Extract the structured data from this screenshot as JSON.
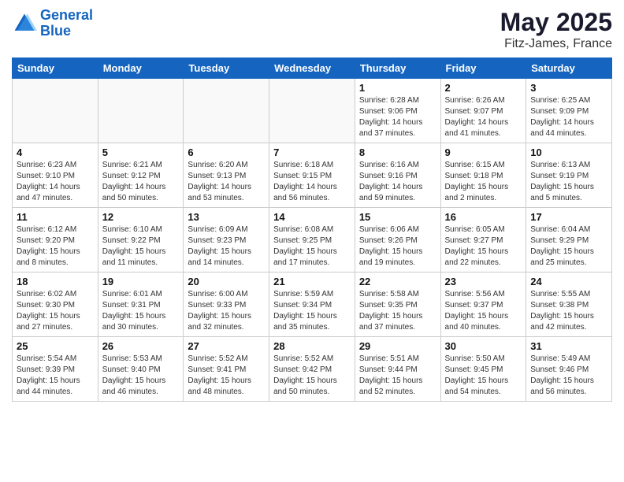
{
  "header": {
    "logo_line1": "General",
    "logo_line2": "Blue",
    "main_title": "May 2025",
    "subtitle": "Fitz-James, France"
  },
  "days_of_week": [
    "Sunday",
    "Monday",
    "Tuesday",
    "Wednesday",
    "Thursday",
    "Friday",
    "Saturday"
  ],
  "weeks": [
    [
      {
        "day": "",
        "info": ""
      },
      {
        "day": "",
        "info": ""
      },
      {
        "day": "",
        "info": ""
      },
      {
        "day": "",
        "info": ""
      },
      {
        "day": "1",
        "info": "Sunrise: 6:28 AM\nSunset: 9:06 PM\nDaylight: 14 hours\nand 37 minutes."
      },
      {
        "day": "2",
        "info": "Sunrise: 6:26 AM\nSunset: 9:07 PM\nDaylight: 14 hours\nand 41 minutes."
      },
      {
        "day": "3",
        "info": "Sunrise: 6:25 AM\nSunset: 9:09 PM\nDaylight: 14 hours\nand 44 minutes."
      }
    ],
    [
      {
        "day": "4",
        "info": "Sunrise: 6:23 AM\nSunset: 9:10 PM\nDaylight: 14 hours\nand 47 minutes."
      },
      {
        "day": "5",
        "info": "Sunrise: 6:21 AM\nSunset: 9:12 PM\nDaylight: 14 hours\nand 50 minutes."
      },
      {
        "day": "6",
        "info": "Sunrise: 6:20 AM\nSunset: 9:13 PM\nDaylight: 14 hours\nand 53 minutes."
      },
      {
        "day": "7",
        "info": "Sunrise: 6:18 AM\nSunset: 9:15 PM\nDaylight: 14 hours\nand 56 minutes."
      },
      {
        "day": "8",
        "info": "Sunrise: 6:16 AM\nSunset: 9:16 PM\nDaylight: 14 hours\nand 59 minutes."
      },
      {
        "day": "9",
        "info": "Sunrise: 6:15 AM\nSunset: 9:18 PM\nDaylight: 15 hours\nand 2 minutes."
      },
      {
        "day": "10",
        "info": "Sunrise: 6:13 AM\nSunset: 9:19 PM\nDaylight: 15 hours\nand 5 minutes."
      }
    ],
    [
      {
        "day": "11",
        "info": "Sunrise: 6:12 AM\nSunset: 9:20 PM\nDaylight: 15 hours\nand 8 minutes."
      },
      {
        "day": "12",
        "info": "Sunrise: 6:10 AM\nSunset: 9:22 PM\nDaylight: 15 hours\nand 11 minutes."
      },
      {
        "day": "13",
        "info": "Sunrise: 6:09 AM\nSunset: 9:23 PM\nDaylight: 15 hours\nand 14 minutes."
      },
      {
        "day": "14",
        "info": "Sunrise: 6:08 AM\nSunset: 9:25 PM\nDaylight: 15 hours\nand 17 minutes."
      },
      {
        "day": "15",
        "info": "Sunrise: 6:06 AM\nSunset: 9:26 PM\nDaylight: 15 hours\nand 19 minutes."
      },
      {
        "day": "16",
        "info": "Sunrise: 6:05 AM\nSunset: 9:27 PM\nDaylight: 15 hours\nand 22 minutes."
      },
      {
        "day": "17",
        "info": "Sunrise: 6:04 AM\nSunset: 9:29 PM\nDaylight: 15 hours\nand 25 minutes."
      }
    ],
    [
      {
        "day": "18",
        "info": "Sunrise: 6:02 AM\nSunset: 9:30 PM\nDaylight: 15 hours\nand 27 minutes."
      },
      {
        "day": "19",
        "info": "Sunrise: 6:01 AM\nSunset: 9:31 PM\nDaylight: 15 hours\nand 30 minutes."
      },
      {
        "day": "20",
        "info": "Sunrise: 6:00 AM\nSunset: 9:33 PM\nDaylight: 15 hours\nand 32 minutes."
      },
      {
        "day": "21",
        "info": "Sunrise: 5:59 AM\nSunset: 9:34 PM\nDaylight: 15 hours\nand 35 minutes."
      },
      {
        "day": "22",
        "info": "Sunrise: 5:58 AM\nSunset: 9:35 PM\nDaylight: 15 hours\nand 37 minutes."
      },
      {
        "day": "23",
        "info": "Sunrise: 5:56 AM\nSunset: 9:37 PM\nDaylight: 15 hours\nand 40 minutes."
      },
      {
        "day": "24",
        "info": "Sunrise: 5:55 AM\nSunset: 9:38 PM\nDaylight: 15 hours\nand 42 minutes."
      }
    ],
    [
      {
        "day": "25",
        "info": "Sunrise: 5:54 AM\nSunset: 9:39 PM\nDaylight: 15 hours\nand 44 minutes."
      },
      {
        "day": "26",
        "info": "Sunrise: 5:53 AM\nSunset: 9:40 PM\nDaylight: 15 hours\nand 46 minutes."
      },
      {
        "day": "27",
        "info": "Sunrise: 5:52 AM\nSunset: 9:41 PM\nDaylight: 15 hours\nand 48 minutes."
      },
      {
        "day": "28",
        "info": "Sunrise: 5:52 AM\nSunset: 9:42 PM\nDaylight: 15 hours\nand 50 minutes."
      },
      {
        "day": "29",
        "info": "Sunrise: 5:51 AM\nSunset: 9:44 PM\nDaylight: 15 hours\nand 52 minutes."
      },
      {
        "day": "30",
        "info": "Sunrise: 5:50 AM\nSunset: 9:45 PM\nDaylight: 15 hours\nand 54 minutes."
      },
      {
        "day": "31",
        "info": "Sunrise: 5:49 AM\nSunset: 9:46 PM\nDaylight: 15 hours\nand 56 minutes."
      }
    ]
  ]
}
